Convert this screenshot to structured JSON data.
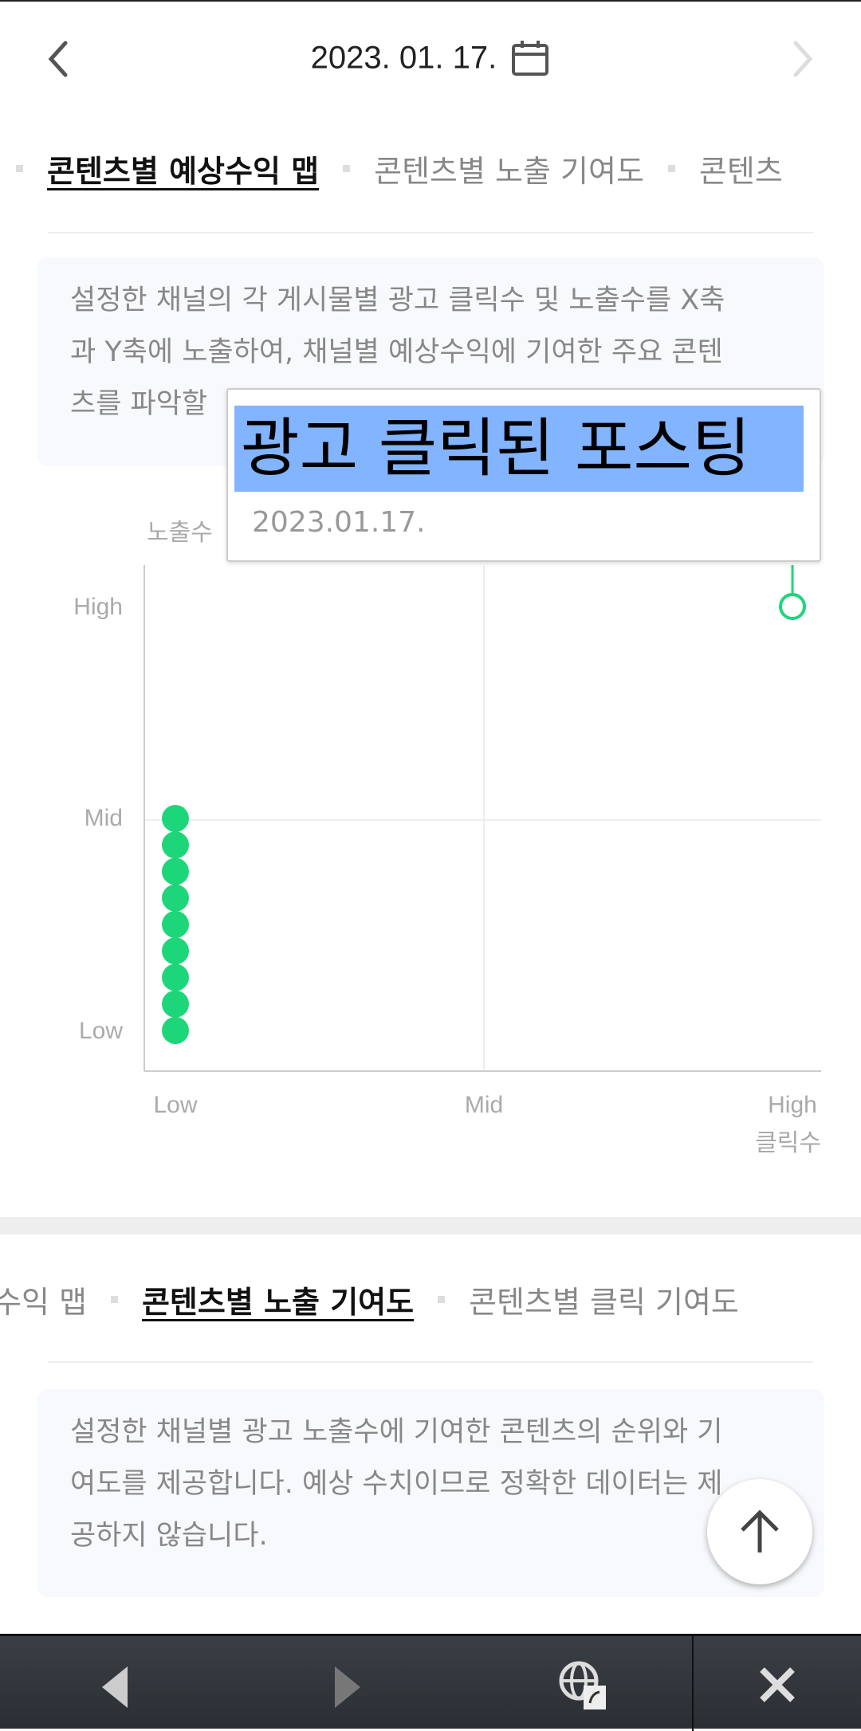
{
  "header": {
    "date": "2023. 01. 17.",
    "prev_icon": "chevron-left-icon",
    "next_icon": "chevron-right-icon",
    "calendar_icon": "calendar-icon"
  },
  "section1": {
    "tabs": [
      {
        "label": "콘텐츠별 예상수익 맵",
        "active": true
      },
      {
        "label": "콘텐츠별 노출 기여도",
        "active": false
      },
      {
        "label": "콘텐츠",
        "active": false
      }
    ],
    "info_lines": [
      "설정한 채널의 각 게시물별 광고 클릭수 및 노출수를 X축",
      "과 Y축에 노출하여, 채널별 예상수익에 기여한 주요 콘텐",
      "츠를 파악할"
    ]
  },
  "tooltip": {
    "title": "광고 클릭된 포스팅",
    "date": "2023.01.17."
  },
  "chart_data": {
    "type": "scatter",
    "xlabel": "클릭수",
    "ylabel": "노출수",
    "x_ticks": [
      "Low",
      "Mid",
      "High"
    ],
    "y_ticks": [
      "Low",
      "Mid",
      "High"
    ],
    "xlim": [
      0,
      2
    ],
    "ylim": [
      0,
      2
    ],
    "grid": true,
    "point_color": "#1ed67a",
    "points": [
      {
        "x": 0,
        "y": 0
      },
      {
        "x": 0,
        "y": 0.125
      },
      {
        "x": 0,
        "y": 0.25
      },
      {
        "x": 0,
        "y": 0.375
      },
      {
        "x": 0,
        "y": 0.5
      },
      {
        "x": 0,
        "y": 0.625
      },
      {
        "x": 0,
        "y": 0.75
      },
      {
        "x": 0,
        "y": 0.875
      },
      {
        "x": 0,
        "y": 1
      },
      {
        "x": 2,
        "y": 2,
        "selected": true
      }
    ]
  },
  "section2": {
    "tabs": [
      {
        "label": "수익 맵",
        "active": false
      },
      {
        "label": "콘텐츠별 노출 기여도",
        "active": true
      },
      {
        "label": "콘텐츠별 클릭 기여도",
        "active": false
      }
    ],
    "info_lines": [
      "설정한 채널별 광고 노출수에 기여한 콘텐츠의 순위와 기",
      "여도를 제공합니다. 예상 수치이므로 정확한 데이터는 제",
      "공하지 않습니다."
    ]
  },
  "scroll_top_icon": "arrow-up-icon",
  "bottom_bar": {
    "icons": [
      "back-triangle-icon",
      "forward-triangle-icon",
      "globe-link-icon",
      "close-icon"
    ]
  }
}
